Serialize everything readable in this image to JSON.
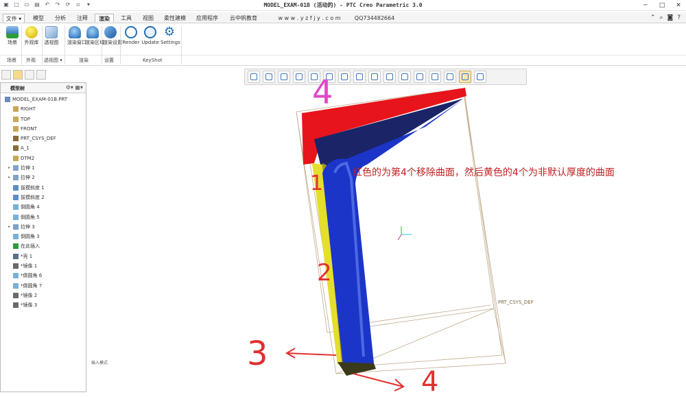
{
  "app": {
    "title": "MODEL_EXAM-01B (活动的) - PTC Creo Parametric 3.0"
  },
  "menu_tabs": [
    {
      "label": "文件 ▾",
      "id": "file"
    },
    {
      "label": "模型",
      "id": "model"
    },
    {
      "label": "分析",
      "id": "analysis"
    },
    {
      "label": "注释",
      "id": "annotate"
    },
    {
      "label": "渲染",
      "id": "render",
      "active": true
    },
    {
      "label": "工具",
      "id": "tools"
    },
    {
      "label": "视图",
      "id": "view"
    },
    {
      "label": "柔性建模",
      "id": "flexible"
    },
    {
      "label": "应用程序",
      "id": "apps"
    },
    {
      "label": "云中帆教育",
      "id": "edu"
    },
    {
      "label": "w w w . y z f j y . c o m",
      "id": "web"
    },
    {
      "label": "QQ734482664",
      "id": "qq"
    }
  ],
  "ribbon": {
    "buttons": [
      {
        "label": "场景",
        "icon": "scene-icon"
      },
      {
        "label": "外观库",
        "icon": "appearance-icon"
      },
      {
        "label": "透视图",
        "icon": "perspective-icon"
      },
      {
        "label": "渲染窗口",
        "icon": "render-window-icon"
      },
      {
        "label": "渲染区域",
        "icon": "render-region-icon"
      },
      {
        "label": "渲染设置",
        "icon": "render-settings-icon"
      },
      {
        "label": "Render",
        "icon": "render-icon"
      },
      {
        "label": "Update",
        "icon": "update-icon"
      },
      {
        "label": "Settings",
        "icon": "settings-gear-icon"
      }
    ],
    "groups": [
      "场景",
      "外观",
      "透视图 ▾",
      "渲染",
      "设置",
      "KeyShot"
    ]
  },
  "model_tree": {
    "title": "模型树",
    "items": [
      {
        "label": "MODEL_EXAM-01B.PRT",
        "level": 0,
        "icon": "part-icon"
      },
      {
        "label": "RIGHT",
        "level": 1,
        "icon": "datum-plane-icon"
      },
      {
        "label": "TOP",
        "level": 1,
        "icon": "datum-plane-icon"
      },
      {
        "label": "FRONT",
        "level": 1,
        "icon": "datum-plane-icon"
      },
      {
        "label": "PRT_CSYS_DEF",
        "level": 1,
        "icon": "csys-icon"
      },
      {
        "label": "A_1",
        "level": 1,
        "icon": "axis-icon"
      },
      {
        "label": "DTM2",
        "level": 1,
        "icon": "datum-plane-icon"
      },
      {
        "label": "拉伸 1",
        "level": 1,
        "icon": "extrude-icon",
        "expandable": true
      },
      {
        "label": "拉伸 2",
        "level": 1,
        "icon": "extrude-icon",
        "expandable": true
      },
      {
        "label": "拔模斜度 1",
        "level": 1,
        "icon": "draft-icon"
      },
      {
        "label": "拔模斜度 2",
        "level": 1,
        "icon": "draft-icon"
      },
      {
        "label": "倒圆角 4",
        "level": 1,
        "icon": "round-icon"
      },
      {
        "label": "倒圆角 5",
        "level": 1,
        "icon": "round-icon"
      },
      {
        "label": "拉伸 3",
        "level": 1,
        "icon": "extrude-icon",
        "expandable": true
      },
      {
        "label": "倒圆角 3",
        "level": 1,
        "icon": "round-icon"
      },
      {
        "label": "在此插入",
        "level": 1,
        "icon": "insert-here-icon"
      },
      {
        "label": "*壳 1",
        "level": 1,
        "icon": "shell-icon"
      },
      {
        "label": "*镜像 1",
        "level": 1,
        "icon": "mirror-icon"
      },
      {
        "label": "*倒圆角 6",
        "level": 1,
        "icon": "round-icon"
      },
      {
        "label": "*倒圆角 7",
        "level": 1,
        "icon": "round-icon"
      },
      {
        "label": "*镜像 2",
        "level": 1,
        "icon": "mirror-icon"
      },
      {
        "label": "*镜像 3",
        "level": 1,
        "icon": "mirror-icon"
      }
    ]
  },
  "status_text": "插入模式",
  "graphics_toolbar": [
    "refit-icon",
    "zoom-in-icon",
    "zoom-out-icon",
    "repaint-icon",
    "display-style-icon",
    "saved-orientations-icon",
    "view-manager-icon",
    "perspective-view-icon",
    "spin-center-icon",
    "annotation-display-icon",
    "plane-display-icon",
    "axis-display-icon",
    "point-display-icon",
    "csys-display-icon",
    "spin-center-toggle-icon",
    "annotations-toggle-icon"
  ],
  "graphics_toolbar_active": [
    14
  ],
  "viewport": {
    "annotation": "红色的为第4个移除曲面，然后黄色的4个为非默认厚度的曲面",
    "csys_label": "PRT_CSYS_DEF",
    "handwritten_numbers": [
      "4",
      "1",
      "2",
      "3",
      "4"
    ],
    "colors": {
      "removed_surface": "#e8141b",
      "non_default_thickness": "#e4de2c",
      "body": "#1b35c8",
      "annotation": "#c02020"
    }
  }
}
